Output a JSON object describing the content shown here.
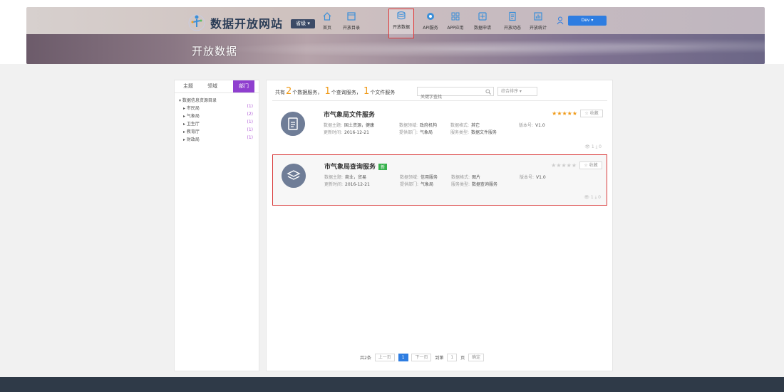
{
  "header": {
    "site_title": "数据开放网站",
    "region_button": "省级 ▾",
    "banner_title": "开放数据",
    "user_button": "Dev ▾",
    "nav": [
      {
        "label": "首页",
        "icon": "home-icon"
      },
      {
        "label": "开放目录",
        "icon": "catalog-icon"
      },
      {
        "label": "开放数据",
        "icon": "data-icon",
        "active": true
      },
      {
        "label": "API服务",
        "icon": "api-icon"
      },
      {
        "label": "APP应用",
        "icon": "app-icon"
      },
      {
        "label": "数据申请",
        "icon": "apply-icon"
      },
      {
        "label": "开放动态",
        "icon": "news-icon"
      },
      {
        "label": "开放统计",
        "icon": "stats-icon"
      }
    ]
  },
  "sidebar": {
    "tabs": [
      "主题",
      "领域",
      "部门"
    ],
    "active_tab": "部门",
    "root": "▾ 数据信息资源目录",
    "items": [
      {
        "label": "▸ 市民局",
        "count": "(1)"
      },
      {
        "label": "▸ 气象局",
        "count": "(2)"
      },
      {
        "label": "▸ 卫生厅",
        "count": "(1)"
      },
      {
        "label": "▸ 教育厅",
        "count": "(1)"
      },
      {
        "label": "▸ 财政局",
        "count": "(1)"
      }
    ]
  },
  "main": {
    "summary": {
      "prefix": "共有",
      "n1": "2",
      "t1": "个数据服务，",
      "n2": "1",
      "t2": "个查询服务，",
      "n3": "1",
      "t3": "个文件服务"
    },
    "search_placeholder": "关键字查找",
    "sort_label": "综合排序 ▾",
    "cards": [
      {
        "title": "市气象局文件服务",
        "badge": "",
        "rating": 5,
        "collect": "☆ 收藏",
        "meta_rows": [
          [
            [
              "数据主题:",
              "国土资源，健康"
            ],
            [
              "数据领域:",
              "政府机构"
            ],
            [
              "数据格式:",
              "其它"
            ],
            [
              "版本号:",
              "V1.0"
            ]
          ],
          [
            [
              "更新时间:",
              "2016-12-21"
            ],
            [
              "提供部门:",
              "气象局"
            ],
            [
              "服务类型:",
              "数据文件服务"
            ]
          ]
        ],
        "stats": "👁 1  ⤓ 0"
      },
      {
        "title": "市气象局查询服务",
        "badge": "新",
        "rating": 0,
        "collect": "☆ 收藏",
        "meta_rows": [
          [
            [
              "数据主题:",
              "商业，贸易"
            ],
            [
              "数据领域:",
              "信用服务"
            ],
            [
              "数据格式:",
              "图片"
            ],
            [
              "版本号:",
              "V1.0"
            ]
          ],
          [
            [
              "更新时间:",
              "2016-12-21"
            ],
            [
              "提供部门:",
              "气象局"
            ],
            [
              "服务类型:",
              "数据查询服务"
            ]
          ]
        ],
        "stats": "👁 1  ⤓ 0"
      }
    ],
    "pagination": {
      "total": "共2条",
      "prev": "上一页",
      "current": "1",
      "next": "下一页",
      "goto": "到第",
      "page_input": "1",
      "page_unit": "页",
      "confirm": "确定"
    }
  },
  "colors": {
    "accent_purple": "#8f3fcf",
    "highlight_red": "#d93a3a",
    "primary_blue": "#2e7de1",
    "star_orange": "#f09a18"
  }
}
